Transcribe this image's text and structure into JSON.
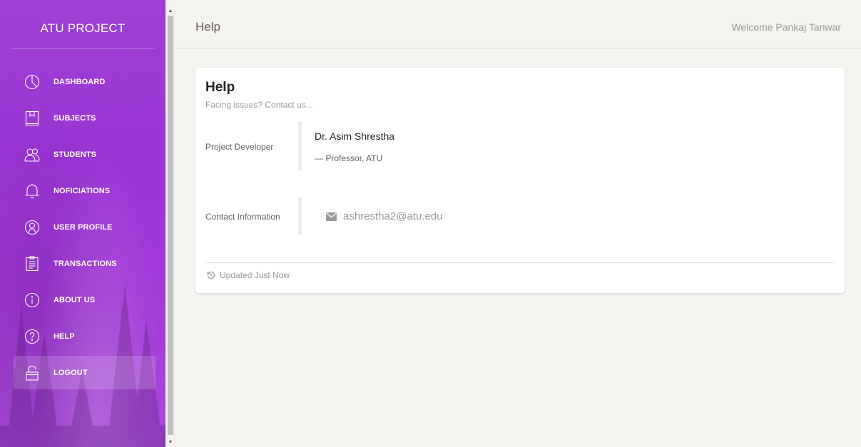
{
  "sidebar": {
    "brand": "ATU PROJECT",
    "items": [
      {
        "label": "DASHBOARD",
        "icon": "pie-chart-icon"
      },
      {
        "label": "SUBJECTS",
        "icon": "book-icon"
      },
      {
        "label": "STUDENTS",
        "icon": "users-icon"
      },
      {
        "label": "NOFICIATIONS",
        "icon": "bell-icon"
      },
      {
        "label": "USER PROFILE",
        "icon": "user-circle-icon"
      },
      {
        "label": "TRANSACTIONS",
        "icon": "clipboard-icon"
      },
      {
        "label": "ABOUT US",
        "icon": "info-icon"
      },
      {
        "label": "HELP",
        "icon": "question-icon"
      },
      {
        "label": "LOGOUT",
        "icon": "lock-icon",
        "active": true
      }
    ]
  },
  "header": {
    "title": "Help",
    "welcome": "Welcome Pankaj Tanwar"
  },
  "card": {
    "title": "Help",
    "subtitle": "Facing issues? Contact us...",
    "developer": {
      "label": "Project Developer",
      "name": "Dr. Asim Shrestha",
      "role": "— Professor, ATU"
    },
    "contact": {
      "label": "Contact Information",
      "email": "ashrestha2@atu.edu",
      "icon": "envelope-icon"
    },
    "footer": {
      "text": "Updated Just Now",
      "icon": "history-icon"
    }
  },
  "colors": {
    "sidebar_purple": "#9c3ad6",
    "background": "#f4f3ef",
    "muted_text": "#9a9a9a"
  }
}
